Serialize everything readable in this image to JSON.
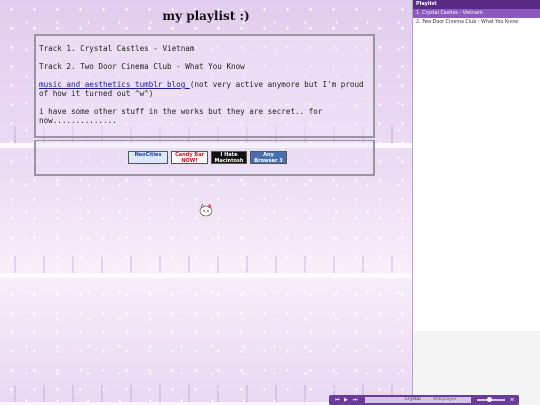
{
  "page": {
    "title": "my playlist :)"
  },
  "content": {
    "track1": "Track 1. Crystal Castles - Vietnam",
    "track2": "Track 2. Two Door Cinema Club - What You Know",
    "link_text": "music and aesthetics tumblr blog ",
    "link_note": "(not very active anymore but I'm proud of how it turned out ^w^)",
    "secret": "i have some other stuff in the works but they are secret.. for now.............."
  },
  "badges": [
    {
      "label": "NeoCities"
    },
    {
      "label": "Candy Bar NOW!"
    },
    {
      "label": "I Hate Macintosh"
    },
    {
      "label": "Any Browser 3"
    }
  ],
  "playlist": {
    "header": "Playlist",
    "items": [
      "1. Crystal Castles - Vietnam",
      "2. Two Door Cinema Club - What You Know"
    ]
  },
  "player": {
    "track": "Crystal",
    "brand": "Wikiplayer"
  }
}
